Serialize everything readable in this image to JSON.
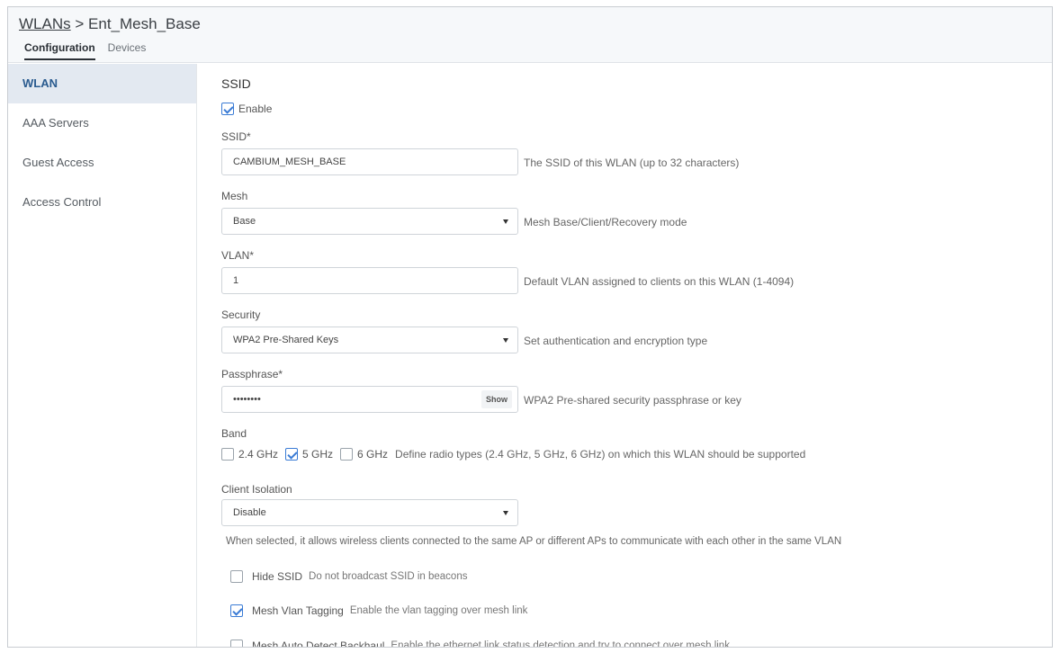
{
  "header": {
    "breadcrumb_root": "WLANs",
    "breadcrumb_sep": ">",
    "breadcrumb_current": "Ent_Mesh_Base",
    "tabs": [
      {
        "label": "Configuration",
        "active": true
      },
      {
        "label": "Devices",
        "active": false
      }
    ]
  },
  "sidebar": {
    "items": [
      {
        "label": "WLAN",
        "active": true
      },
      {
        "label": "AAA Servers",
        "active": false
      },
      {
        "label": "Guest Access",
        "active": false
      },
      {
        "label": "Access Control",
        "active": false
      }
    ]
  },
  "form": {
    "section_title": "SSID",
    "enable": {
      "label": "Enable",
      "checked": true
    },
    "ssid": {
      "label": "SSID*",
      "value": "CAMBIUM_MESH_BASE",
      "hint": "The SSID of this WLAN (up to 32 characters)"
    },
    "mesh": {
      "label": "Mesh",
      "value": "Base",
      "hint": "Mesh Base/Client/Recovery mode"
    },
    "vlan": {
      "label": "VLAN*",
      "value": "1",
      "hint": "Default VLAN assigned to clients on this WLAN (1-4094)"
    },
    "security": {
      "label": "Security",
      "value": "WPA2 Pre-Shared Keys",
      "hint": "Set authentication and encryption type"
    },
    "passphrase": {
      "label": "Passphrase*",
      "value": "••••••••",
      "show_label": "Show",
      "hint": "WPA2 Pre-shared security passphrase or key"
    },
    "band": {
      "label": "Band",
      "options": [
        {
          "label": "2.4 GHz",
          "checked": false
        },
        {
          "label": "5 GHz",
          "checked": true
        },
        {
          "label": "6 GHz",
          "checked": false
        }
      ],
      "hint": "Define radio types (2.4 GHz, 5 GHz, 6 GHz) on which this WLAN should be supported"
    },
    "client_isolation": {
      "label": "Client Isolation",
      "value": "Disable",
      "note": "When selected, it allows wireless clients connected to the same AP or different APs to communicate with each other in the same VLAN"
    },
    "hide_ssid": {
      "label": "Hide SSID",
      "desc": "Do not broadcast SSID in beacons",
      "checked": false
    },
    "mesh_vlan_tagging": {
      "label": "Mesh Vlan Tagging",
      "desc": "Enable the vlan tagging over mesh link",
      "checked": true
    },
    "mesh_auto_detect": {
      "label": "Mesh Auto Detect Backhaul",
      "desc": "Enable the ethernet link status detection and try to connect over mesh link",
      "checked": false
    }
  },
  "colors": {
    "accent": "#3a7bd5",
    "sidebar_active_bg": "#e3e9f1",
    "sidebar_active_text": "#2a5b8f",
    "header_bg": "#f6f8fa"
  }
}
